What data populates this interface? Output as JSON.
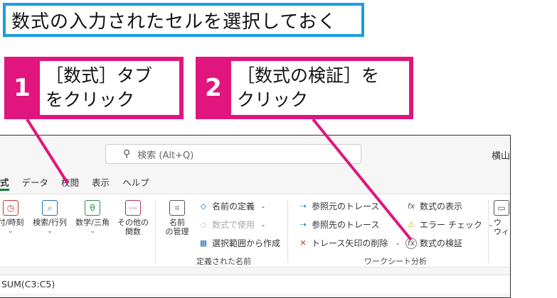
{
  "instruction": "数式の入力されたセルを選択しておく",
  "steps": [
    {
      "number": "1",
      "line1": "［数式］タブ",
      "line2": "をクリック"
    },
    {
      "number": "2",
      "line1": "［数式の検証］を",
      "line2": "クリック"
    }
  ],
  "titlebar": {
    "search_placeholder": "検索 (Alt+Q)",
    "user": "横山"
  },
  "tabs": [
    "式",
    "データ",
    "校閲",
    "表示",
    "ヘルプ"
  ],
  "ribbon": {
    "function_buttons": [
      {
        "label1": "付/時刻",
        "icon": "calendar-icon"
      },
      {
        "label1": "検索/行列",
        "icon": "magnifier-icon"
      },
      {
        "label1": "数学/三角",
        "icon": "theta-icon"
      },
      {
        "label1": "その他の",
        "label2": "関数",
        "icon": "more-functions-icon"
      }
    ],
    "name_manager": {
      "label1": "名前",
      "label2": "の管理"
    },
    "defined_names": {
      "define_name": "名前の定義",
      "use_in_formula": "数式で使用",
      "create_from_selection": "選択範囲から作成",
      "group_label": "定義された名前"
    },
    "auditing": {
      "trace_precedents": "参照元のトレース",
      "trace_dependents": "参照先のトレース",
      "remove_arrows": "トレース矢印の削除",
      "show_formulas": "数式の表示",
      "error_checking": "エラー チェック",
      "evaluate_formula": "数式の検証",
      "group_label": "ワークシート分析"
    },
    "watch": {
      "label1": "ウ",
      "label2": "ウィ"
    }
  },
  "formula": "SUM(C3:C5)",
  "colors": {
    "banner_border": "#1a9ee0",
    "callout": "#e0157e",
    "leader": "#e0157e"
  }
}
